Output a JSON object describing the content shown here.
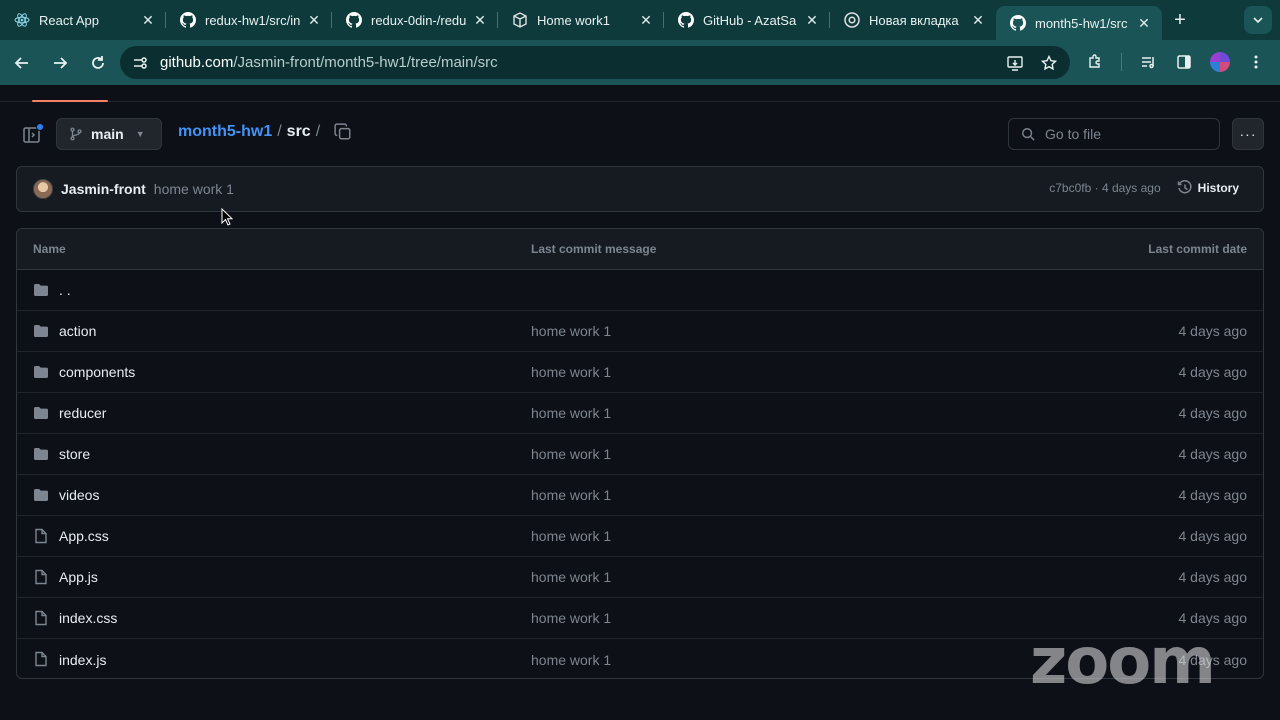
{
  "browser": {
    "tabs": [
      {
        "label": "React App",
        "icon": "react-icon"
      },
      {
        "label": "redux-hw1/src/in",
        "icon": "github-icon"
      },
      {
        "label": "redux-0din-/redu",
        "icon": "github-icon"
      },
      {
        "label": "Home work1",
        "icon": "codesandbox-icon"
      },
      {
        "label": "GitHub - AzatSa",
        "icon": "github-icon"
      },
      {
        "label": "Новая вкладка",
        "icon": "chrome-icon"
      },
      {
        "label": "month5-hw1/src",
        "icon": "github-icon",
        "active": true
      }
    ],
    "url_host": "github.com",
    "url_path": "/Jasmin-front/month5-hw1/tree/main/src"
  },
  "repo": {
    "branch": "main",
    "repo_name": "month5-hw1",
    "current_dir": "src",
    "slash": "/",
    "goto_placeholder": "Go to file",
    "more": "···"
  },
  "commit": {
    "author": "Jasmin-front",
    "message": "home work 1",
    "meta": "c7bc0fb · 4 days ago",
    "history_label": "History"
  },
  "table": {
    "headers": {
      "name": "Name",
      "message": "Last commit message",
      "date": "Last commit date"
    },
    "parent": ". .",
    "rows": [
      {
        "name": "action",
        "type": "folder",
        "message": "home work 1",
        "date": "4 days ago"
      },
      {
        "name": "components",
        "type": "folder",
        "message": "home work 1",
        "date": "4 days ago"
      },
      {
        "name": "reducer",
        "type": "folder",
        "message": "home work 1",
        "date": "4 days ago"
      },
      {
        "name": "store",
        "type": "folder",
        "message": "home work 1",
        "date": "4 days ago"
      },
      {
        "name": "videos",
        "type": "folder",
        "message": "home work 1",
        "date": "4 days ago"
      },
      {
        "name": "App.css",
        "type": "file",
        "message": "home work 1",
        "date": "4 days ago"
      },
      {
        "name": "App.js",
        "type": "file",
        "message": "home work 1",
        "date": "4 days ago"
      },
      {
        "name": "index.css",
        "type": "file",
        "message": "home work 1",
        "date": "4 days ago"
      },
      {
        "name": "index.js",
        "type": "file",
        "message": "home work 1",
        "date": "4 days ago"
      }
    ]
  },
  "watermark": "zoom",
  "colors": {
    "accent": "#4493f8",
    "tab_bg": "#0e3a3c",
    "toolbar_bg": "#1b5456",
    "page_bg": "#0d1117"
  }
}
